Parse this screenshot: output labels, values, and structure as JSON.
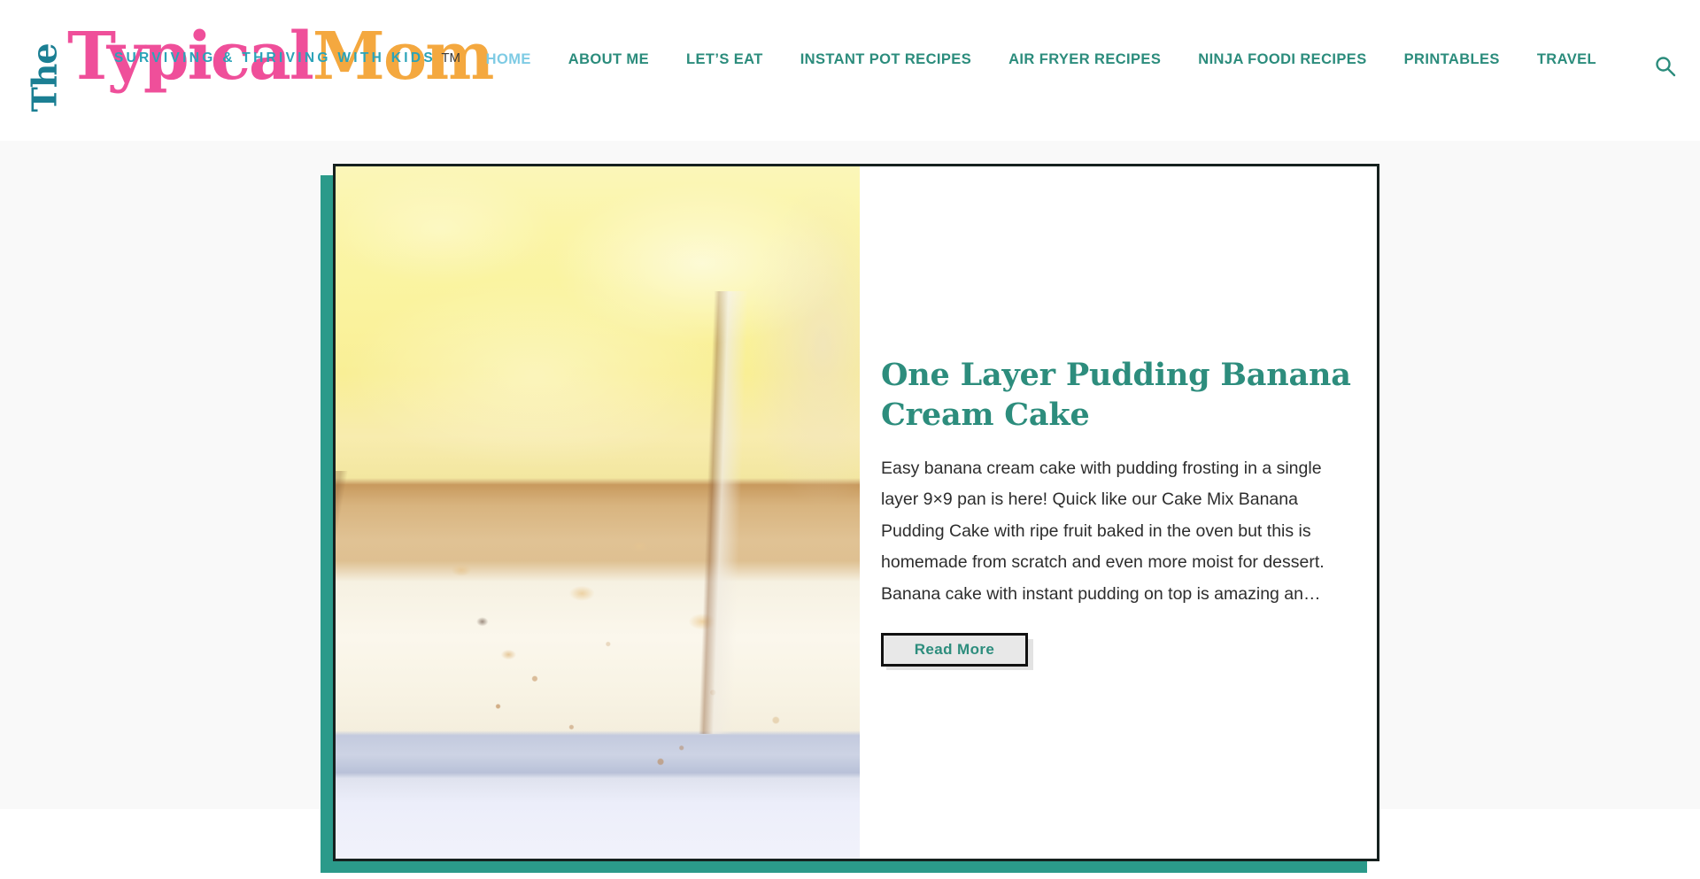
{
  "site": {
    "logo": {
      "word_the": "The",
      "word_typical": "Typical",
      "word_mom": "Mom",
      "trademark": "TM",
      "tagline": "SURVIVING & THRIVING WITH KIDS",
      "color_the": "#1b7f93",
      "color_typical": "#ef4f9a",
      "color_mom": "#f4a83f",
      "color_tagline": "#2aa3b8"
    }
  },
  "nav": {
    "items": [
      {
        "label": "HOME",
        "active": true
      },
      {
        "label": "ABOUT ME",
        "active": false
      },
      {
        "label": "LET’S EAT",
        "active": false
      },
      {
        "label": "INSTANT POT RECIPES",
        "active": false
      },
      {
        "label": "AIR FRYER RECIPES",
        "active": false
      },
      {
        "label": "NINJA FOODI RECIPES",
        "active": false
      },
      {
        "label": "PRINTABLES",
        "active": false
      },
      {
        "label": "TRAVEL",
        "active": false
      }
    ],
    "active_color": "#7ecbe4",
    "link_color": "#2b8c7c",
    "search_icon": "search-icon"
  },
  "featured": {
    "title": "One Layer Pudding Banana Cream Cake",
    "excerpt": "Easy banana cream cake with pudding frosting in a single layer 9×9 pan is here! Quick like our Cake Mix Banana Pudding Cake with ripe fruit baked in the oven but this is homemade from scratch and even more moist for dessert. Banana cake with instant pudding on top is amazing an…",
    "read_more_label": "Read More",
    "image_alt": "One layer banana cake with pale yellow pudding frosting on parchment paper in a 9x9 pan",
    "accent_color": "#2b9a8a",
    "title_color": "#2d8d7d",
    "border_color": "#16211f"
  },
  "colors": {
    "page_background": "#ffffff",
    "content_background": "#f9f9f9",
    "teal": "#2b9a8a",
    "button_background": "#e8e8e8"
  }
}
